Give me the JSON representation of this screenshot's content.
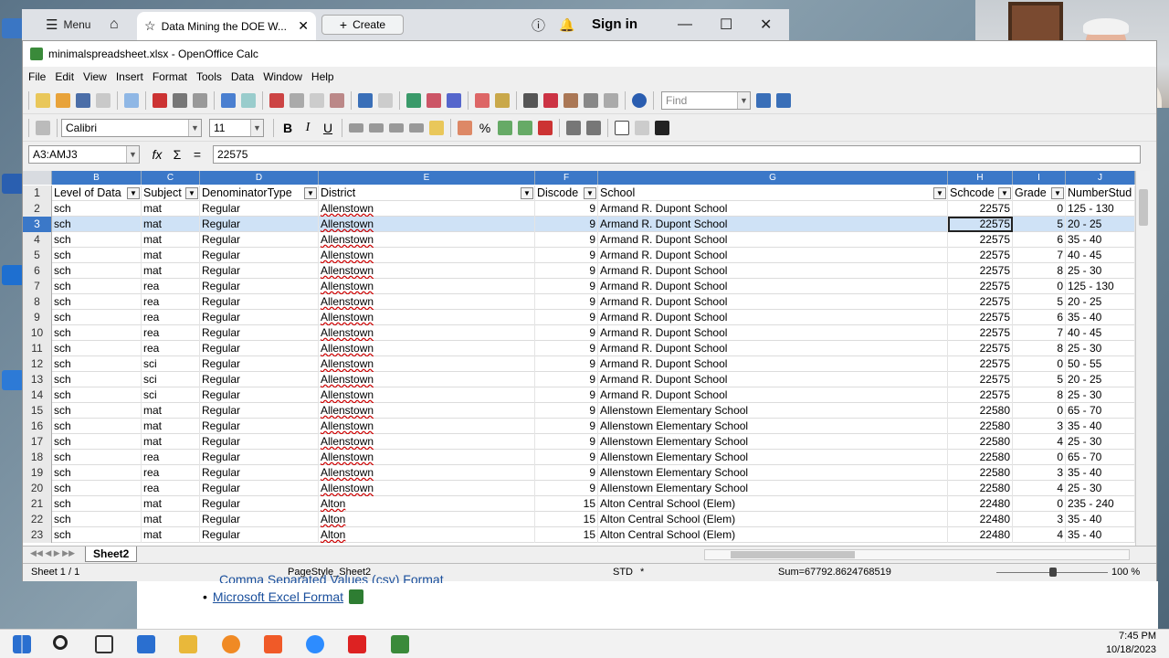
{
  "browser": {
    "menu_label": "Menu",
    "tab_title": "Data Mining the DOE W...",
    "create_label": "Create",
    "signin_label": "Sign in"
  },
  "app": {
    "window_title": "minimalspreadsheet.xlsx - OpenOffice Calc",
    "menus": [
      "File",
      "Edit",
      "View",
      "Insert",
      "Format",
      "Tools",
      "Data",
      "Window",
      "Help"
    ],
    "find_placeholder": "Find",
    "font_name": "Calibri",
    "font_size": "11",
    "name_box": "A3:AMJ3",
    "formula_value": "22575",
    "columns": [
      "B",
      "C",
      "D",
      "E",
      "F",
      "G",
      "H",
      "I",
      "J"
    ],
    "header_row": {
      "row": "1",
      "cells": [
        "Level of Data",
        "Subject",
        "DenominatorType",
        "District",
        "Discode",
        "School",
        "Schcode",
        "Grade",
        "NumberStud"
      ]
    },
    "rows": [
      {
        "row": "2",
        "b": "sch",
        "c": "mat",
        "d": "Regular",
        "e": "Allenstown",
        "f": "9",
        "g": "Armand R. Dupont School",
        "h": "22575",
        "i": "0",
        "j": "125 - 130"
      },
      {
        "row": "3",
        "b": "sch",
        "c": "mat",
        "d": "Regular",
        "e": "Allenstown",
        "f": "9",
        "g": "Armand R. Dupont School",
        "h": "22575",
        "i": "5",
        "j": "20 - 25"
      },
      {
        "row": "4",
        "b": "sch",
        "c": "mat",
        "d": "Regular",
        "e": "Allenstown",
        "f": "9",
        "g": "Armand R. Dupont School",
        "h": "22575",
        "i": "6",
        "j": "35 - 40"
      },
      {
        "row": "5",
        "b": "sch",
        "c": "mat",
        "d": "Regular",
        "e": "Allenstown",
        "f": "9",
        "g": "Armand R. Dupont School",
        "h": "22575",
        "i": "7",
        "j": "40 - 45"
      },
      {
        "row": "6",
        "b": "sch",
        "c": "mat",
        "d": "Regular",
        "e": "Allenstown",
        "f": "9",
        "g": "Armand R. Dupont School",
        "h": "22575",
        "i": "8",
        "j": "25 - 30"
      },
      {
        "row": "7",
        "b": "sch",
        "c": "rea",
        "d": "Regular",
        "e": "Allenstown",
        "f": "9",
        "g": "Armand R. Dupont School",
        "h": "22575",
        "i": "0",
        "j": "125 - 130"
      },
      {
        "row": "8",
        "b": "sch",
        "c": "rea",
        "d": "Regular",
        "e": "Allenstown",
        "f": "9",
        "g": "Armand R. Dupont School",
        "h": "22575",
        "i": "5",
        "j": "20 - 25"
      },
      {
        "row": "9",
        "b": "sch",
        "c": "rea",
        "d": "Regular",
        "e": "Allenstown",
        "f": "9",
        "g": "Armand R. Dupont School",
        "h": "22575",
        "i": "6",
        "j": "35 - 40"
      },
      {
        "row": "10",
        "b": "sch",
        "c": "rea",
        "d": "Regular",
        "e": "Allenstown",
        "f": "9",
        "g": "Armand R. Dupont School",
        "h": "22575",
        "i": "7",
        "j": "40 - 45"
      },
      {
        "row": "11",
        "b": "sch",
        "c": "rea",
        "d": "Regular",
        "e": "Allenstown",
        "f": "9",
        "g": "Armand R. Dupont School",
        "h": "22575",
        "i": "8",
        "j": "25 - 30"
      },
      {
        "row": "12",
        "b": "sch",
        "c": "sci",
        "d": "Regular",
        "e": "Allenstown",
        "f": "9",
        "g": "Armand R. Dupont School",
        "h": "22575",
        "i": "0",
        "j": "50 - 55"
      },
      {
        "row": "13",
        "b": "sch",
        "c": "sci",
        "d": "Regular",
        "e": "Allenstown",
        "f": "9",
        "g": "Armand R. Dupont School",
        "h": "22575",
        "i": "5",
        "j": "20 - 25"
      },
      {
        "row": "14",
        "b": "sch",
        "c": "sci",
        "d": "Regular",
        "e": "Allenstown",
        "f": "9",
        "g": "Armand R. Dupont School",
        "h": "22575",
        "i": "8",
        "j": "25 - 30"
      },
      {
        "row": "15",
        "b": "sch",
        "c": "mat",
        "d": "Regular",
        "e": "Allenstown",
        "f": "9",
        "g": "Allenstown Elementary School",
        "h": "22580",
        "i": "0",
        "j": "65 - 70"
      },
      {
        "row": "16",
        "b": "sch",
        "c": "mat",
        "d": "Regular",
        "e": "Allenstown",
        "f": "9",
        "g": "Allenstown Elementary School",
        "h": "22580",
        "i": "3",
        "j": "35 - 40"
      },
      {
        "row": "17",
        "b": "sch",
        "c": "mat",
        "d": "Regular",
        "e": "Allenstown",
        "f": "9",
        "g": "Allenstown Elementary School",
        "h": "22580",
        "i": "4",
        "j": "25 - 30"
      },
      {
        "row": "18",
        "b": "sch",
        "c": "rea",
        "d": "Regular",
        "e": "Allenstown",
        "f": "9",
        "g": "Allenstown Elementary School",
        "h": "22580",
        "i": "0",
        "j": "65 - 70"
      },
      {
        "row": "19",
        "b": "sch",
        "c": "rea",
        "d": "Regular",
        "e": "Allenstown",
        "f": "9",
        "g": "Allenstown Elementary School",
        "h": "22580",
        "i": "3",
        "j": "35 - 40"
      },
      {
        "row": "20",
        "b": "sch",
        "c": "rea",
        "d": "Regular",
        "e": "Allenstown",
        "f": "9",
        "g": "Allenstown Elementary School",
        "h": "22580",
        "i": "4",
        "j": "25 - 30"
      },
      {
        "row": "21",
        "b": "sch",
        "c": "mat",
        "d": "Regular",
        "e": "Alton",
        "f": "15",
        "g": "Alton Central School (Elem)",
        "h": "22480",
        "i": "0",
        "j": "235 - 240"
      },
      {
        "row": "22",
        "b": "sch",
        "c": "mat",
        "d": "Regular",
        "e": "Alton",
        "f": "15",
        "g": "Alton Central School (Elem)",
        "h": "22480",
        "i": "3",
        "j": "35 - 40"
      },
      {
        "row": "23",
        "b": "sch",
        "c": "mat",
        "d": "Regular",
        "e": "Alton",
        "f": "15",
        "g": "Alton Central School (Elem)",
        "h": "22480",
        "i": "4",
        "j": "35 - 40"
      }
    ],
    "selected_row": "3",
    "sheet_tab": "Sheet2",
    "status": {
      "sheet": "Sheet 1 / 1",
      "page_style": "PageStyle_Sheet2",
      "mode": "STD",
      "modified": "*",
      "sum": "Sum=67792.8624768519",
      "zoom": "100 %"
    }
  },
  "webpage": {
    "link1": "Comma Separated Values (csv) Format",
    "link2": "Microsoft Excel Format"
  },
  "taskbar": {
    "time": "7:45 PM",
    "date": "10/18/2023"
  },
  "colors": {
    "header_blue": "#3b78c8",
    "selection": "#cfe2f6"
  }
}
